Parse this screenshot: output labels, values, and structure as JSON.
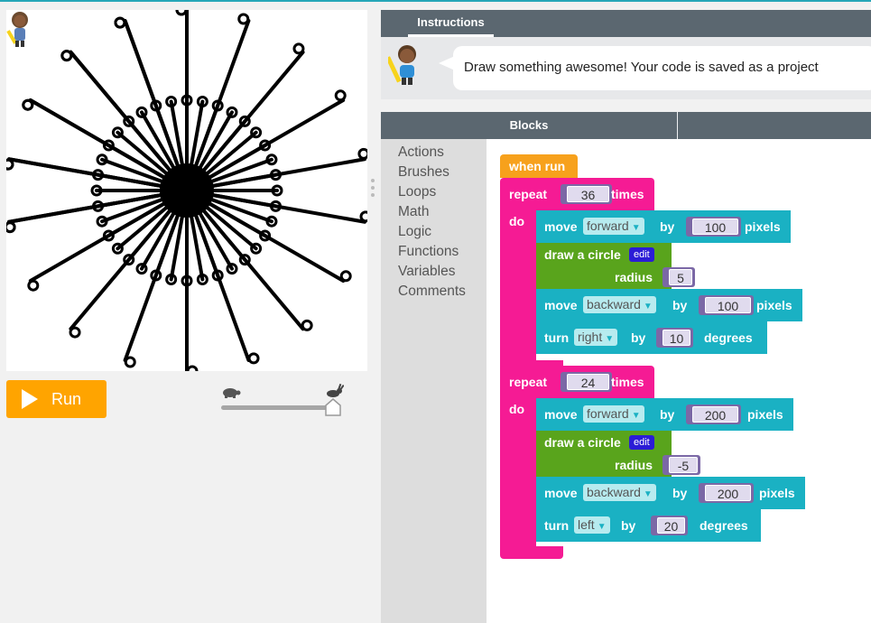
{
  "run_button": {
    "label": "Run",
    "icon": "play-icon"
  },
  "speed": {
    "slow_icon": "tortoise-icon",
    "fast_icon": "hare-icon",
    "value_fraction": 1.0
  },
  "instructions": {
    "tab_label": "Instructions",
    "text": "Draw something awesome! Your code is saved as a project"
  },
  "blocks_panel": {
    "title": "Blocks"
  },
  "toolbox": [
    "Actions",
    "Brushes",
    "Loops",
    "Math",
    "Logic",
    "Functions",
    "Variables",
    "Comments"
  ],
  "program": {
    "event": "when run",
    "loop1": {
      "repeat": "repeat",
      "count": "36",
      "times": "times",
      "do": "do",
      "move1": {
        "label": "move",
        "dir": "forward",
        "by": "by",
        "amount": "100",
        "unit": "pixels"
      },
      "circle": {
        "label": "draw a circle",
        "edit": "edit",
        "radius_label": "radius",
        "radius": "5"
      },
      "move2": {
        "label": "move",
        "dir": "backward",
        "by": "by",
        "amount": "100",
        "unit": "pixels"
      },
      "turn": {
        "label": "turn",
        "dir": "right",
        "by": "by",
        "amount": "10",
        "unit": "degrees"
      }
    },
    "loop2": {
      "repeat": "repeat",
      "count": "24",
      "times": "times",
      "do": "do",
      "move1": {
        "label": "move",
        "dir": "forward",
        "by": "by",
        "amount": "200",
        "unit": "pixels"
      },
      "circle": {
        "label": "draw a circle",
        "edit": "edit",
        "radius_label": "radius",
        "radius": "-5"
      },
      "move2": {
        "label": "move",
        "dir": "backward",
        "by": "by",
        "amount": "200",
        "unit": "pixels"
      },
      "turn": {
        "label": "turn",
        "dir": "left",
        "by": "by",
        "amount": "20",
        "unit": "degrees"
      }
    }
  },
  "drawing": {
    "inner_spokes": 36,
    "inner_length": 100,
    "inner_circle_radius": 5,
    "inner_turn_deg": 10,
    "outer_spokes": 24,
    "outer_length": 200,
    "outer_circle_radius": 5,
    "outer_turn_deg": 20
  },
  "colors": {
    "event": "#f7a11c",
    "loop": "#f51b94",
    "motion": "#1ab1c3",
    "brush": "#59a41c",
    "run": "#ffa400",
    "header": "#5b6770"
  }
}
